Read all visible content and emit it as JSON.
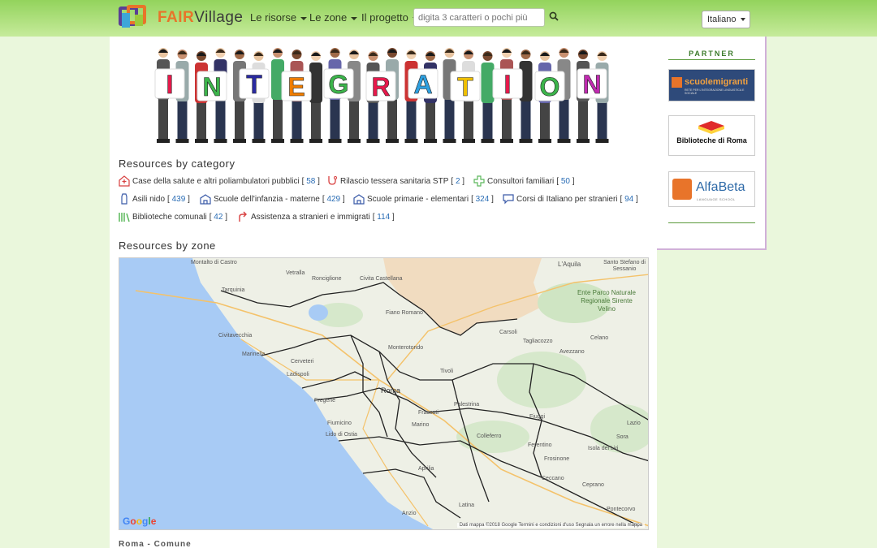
{
  "header": {
    "logo_fair": "FAIR",
    "logo_village": "Village",
    "nav": [
      {
        "label": "Le risorse"
      },
      {
        "label": "Le zone"
      },
      {
        "label": "Il progetto"
      }
    ],
    "search_placeholder": "digita 3 caratteri o pochi più",
    "language": "Italiano"
  },
  "banner": {
    "letters": [
      "I",
      "N",
      "T",
      "E",
      "G",
      "R",
      "A",
      "T",
      "I",
      "O",
      "N"
    ],
    "letter_colors": [
      "#e6194b",
      "#3cb44b",
      "#2a2aa0",
      "#f07d00",
      "#3cb44b",
      "#e6194b",
      "#2fa0e0",
      "#f0c000",
      "#e6194b",
      "#3cb44b",
      "#c02ab0"
    ]
  },
  "resources_by_category": {
    "title": "Resources by category",
    "items": [
      {
        "label": "Case della salute e altri poliambulatori pubblici",
        "count": "58",
        "icon": "hospital-icon",
        "color": "#d84040"
      },
      {
        "label": "Rilascio tessera sanitaria STP",
        "count": "2",
        "icon": "stethoscope-icon",
        "color": "#d84040"
      },
      {
        "label": "Consultori familiari",
        "count": "50",
        "icon": "cross-icon",
        "color": "#5cb85c"
      },
      {
        "label": "Asili nido",
        "count": "439",
        "icon": "baby-bottle-icon",
        "color": "#3a5aa8"
      },
      {
        "label": "Scuole dell'infanzia - materne",
        "count": "429",
        "icon": "school-icon",
        "color": "#3a5aa8"
      },
      {
        "label": "Scuole primarie - elementari",
        "count": "324",
        "icon": "school-icon",
        "color": "#3a5aa8"
      },
      {
        "label": "Corsi di Italiano per stranieri",
        "count": "94",
        "icon": "speech-icon",
        "color": "#3a5aa8"
      },
      {
        "label": "Biblioteche comunali",
        "count": "42",
        "icon": "books-icon",
        "color": "#5cb85c"
      },
      {
        "label": "Assistenza a stranieri e immigrati",
        "count": "114",
        "icon": "arrow-icon",
        "color": "#d84040"
      }
    ]
  },
  "resources_by_zone": {
    "title": "Resources by zone",
    "map": {
      "places": [
        "Montalto di Castro",
        "Tarquinia",
        "Vetralla",
        "Ronciglione",
        "Civita Castellana",
        "Civitavecchia",
        "Marinella",
        "Cerveteri",
        "Ladispoli",
        "Fregene",
        "Fiumicino",
        "Lido di Ostia",
        "Roma",
        "Monterotondo",
        "Tivoli",
        "Palestrina",
        "Frascati",
        "Marino",
        "Colleferro",
        "Fiuggi",
        "Ferentino",
        "Frosinone",
        "Anzio",
        "Latina",
        "Ceccano",
        "Ceprano",
        "Isola del Liri",
        "Sora",
        "Pontecorvo",
        "Avezzano",
        "Celano",
        "Tagliacozzo",
        "Carsoli",
        "L'Aquila",
        "Santo Stefano di Sessanio",
        "Ente Parco Naturale Regionale Sirente Velino",
        "Aprilia",
        "Fiano Romano",
        "Lazio"
      ],
      "google": "Google",
      "attribution": "Dati mappa ©2018 Google   Termini e condizioni d'uso   Segnala un errore nella mappa"
    }
  },
  "bottom_heading": "Roma - Comune",
  "sidebar": {
    "title": "PARTNER",
    "partners": [
      {
        "name": "scuolemigranti",
        "sub": "RETE PER L'INTEGRAZIONE LINGUISTICA E SOCIALE"
      },
      {
        "name": "Biblioteche di Roma"
      },
      {
        "name": "AlfaBeta",
        "sub": "LANGUAGE SCHOOL"
      }
    ]
  }
}
